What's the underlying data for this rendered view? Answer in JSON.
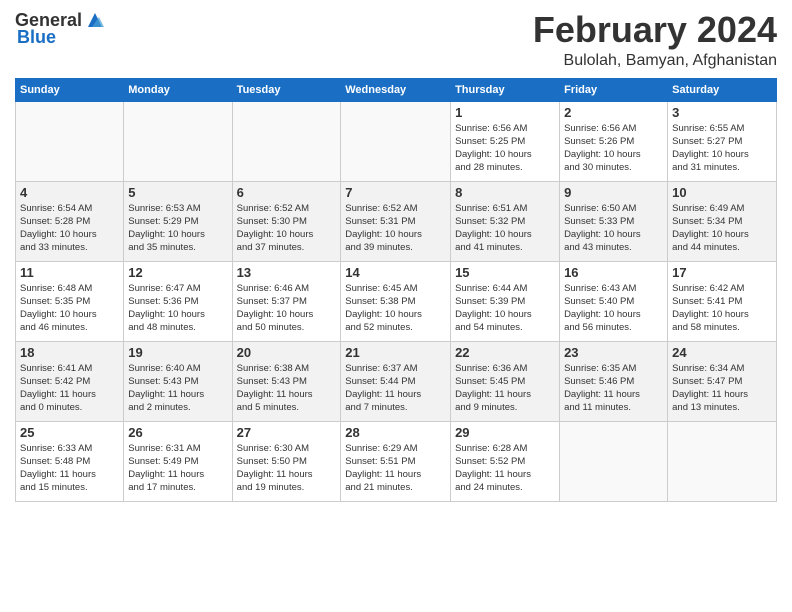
{
  "header": {
    "logo_line1": "General",
    "logo_line2": "Blue",
    "month_title": "February 2024",
    "location": "Bulolah, Bamyan, Afghanistan"
  },
  "weekdays": [
    "Sunday",
    "Monday",
    "Tuesday",
    "Wednesday",
    "Thursday",
    "Friday",
    "Saturday"
  ],
  "weeks": [
    [
      {
        "day": "",
        "info": ""
      },
      {
        "day": "",
        "info": ""
      },
      {
        "day": "",
        "info": ""
      },
      {
        "day": "",
        "info": ""
      },
      {
        "day": "1",
        "info": "Sunrise: 6:56 AM\nSunset: 5:25 PM\nDaylight: 10 hours\nand 28 minutes."
      },
      {
        "day": "2",
        "info": "Sunrise: 6:56 AM\nSunset: 5:26 PM\nDaylight: 10 hours\nand 30 minutes."
      },
      {
        "day": "3",
        "info": "Sunrise: 6:55 AM\nSunset: 5:27 PM\nDaylight: 10 hours\nand 31 minutes."
      }
    ],
    [
      {
        "day": "4",
        "info": "Sunrise: 6:54 AM\nSunset: 5:28 PM\nDaylight: 10 hours\nand 33 minutes."
      },
      {
        "day": "5",
        "info": "Sunrise: 6:53 AM\nSunset: 5:29 PM\nDaylight: 10 hours\nand 35 minutes."
      },
      {
        "day": "6",
        "info": "Sunrise: 6:52 AM\nSunset: 5:30 PM\nDaylight: 10 hours\nand 37 minutes."
      },
      {
        "day": "7",
        "info": "Sunrise: 6:52 AM\nSunset: 5:31 PM\nDaylight: 10 hours\nand 39 minutes."
      },
      {
        "day": "8",
        "info": "Sunrise: 6:51 AM\nSunset: 5:32 PM\nDaylight: 10 hours\nand 41 minutes."
      },
      {
        "day": "9",
        "info": "Sunrise: 6:50 AM\nSunset: 5:33 PM\nDaylight: 10 hours\nand 43 minutes."
      },
      {
        "day": "10",
        "info": "Sunrise: 6:49 AM\nSunset: 5:34 PM\nDaylight: 10 hours\nand 44 minutes."
      }
    ],
    [
      {
        "day": "11",
        "info": "Sunrise: 6:48 AM\nSunset: 5:35 PM\nDaylight: 10 hours\nand 46 minutes."
      },
      {
        "day": "12",
        "info": "Sunrise: 6:47 AM\nSunset: 5:36 PM\nDaylight: 10 hours\nand 48 minutes."
      },
      {
        "day": "13",
        "info": "Sunrise: 6:46 AM\nSunset: 5:37 PM\nDaylight: 10 hours\nand 50 minutes."
      },
      {
        "day": "14",
        "info": "Sunrise: 6:45 AM\nSunset: 5:38 PM\nDaylight: 10 hours\nand 52 minutes."
      },
      {
        "day": "15",
        "info": "Sunrise: 6:44 AM\nSunset: 5:39 PM\nDaylight: 10 hours\nand 54 minutes."
      },
      {
        "day": "16",
        "info": "Sunrise: 6:43 AM\nSunset: 5:40 PM\nDaylight: 10 hours\nand 56 minutes."
      },
      {
        "day": "17",
        "info": "Sunrise: 6:42 AM\nSunset: 5:41 PM\nDaylight: 10 hours\nand 58 minutes."
      }
    ],
    [
      {
        "day": "18",
        "info": "Sunrise: 6:41 AM\nSunset: 5:42 PM\nDaylight: 11 hours\nand 0 minutes."
      },
      {
        "day": "19",
        "info": "Sunrise: 6:40 AM\nSunset: 5:43 PM\nDaylight: 11 hours\nand 2 minutes."
      },
      {
        "day": "20",
        "info": "Sunrise: 6:38 AM\nSunset: 5:43 PM\nDaylight: 11 hours\nand 5 minutes."
      },
      {
        "day": "21",
        "info": "Sunrise: 6:37 AM\nSunset: 5:44 PM\nDaylight: 11 hours\nand 7 minutes."
      },
      {
        "day": "22",
        "info": "Sunrise: 6:36 AM\nSunset: 5:45 PM\nDaylight: 11 hours\nand 9 minutes."
      },
      {
        "day": "23",
        "info": "Sunrise: 6:35 AM\nSunset: 5:46 PM\nDaylight: 11 hours\nand 11 minutes."
      },
      {
        "day": "24",
        "info": "Sunrise: 6:34 AM\nSunset: 5:47 PM\nDaylight: 11 hours\nand 13 minutes."
      }
    ],
    [
      {
        "day": "25",
        "info": "Sunrise: 6:33 AM\nSunset: 5:48 PM\nDaylight: 11 hours\nand 15 minutes."
      },
      {
        "day": "26",
        "info": "Sunrise: 6:31 AM\nSunset: 5:49 PM\nDaylight: 11 hours\nand 17 minutes."
      },
      {
        "day": "27",
        "info": "Sunrise: 6:30 AM\nSunset: 5:50 PM\nDaylight: 11 hours\nand 19 minutes."
      },
      {
        "day": "28",
        "info": "Sunrise: 6:29 AM\nSunset: 5:51 PM\nDaylight: 11 hours\nand 21 minutes."
      },
      {
        "day": "29",
        "info": "Sunrise: 6:28 AM\nSunset: 5:52 PM\nDaylight: 11 hours\nand 24 minutes."
      },
      {
        "day": "",
        "info": ""
      },
      {
        "day": "",
        "info": ""
      }
    ]
  ]
}
